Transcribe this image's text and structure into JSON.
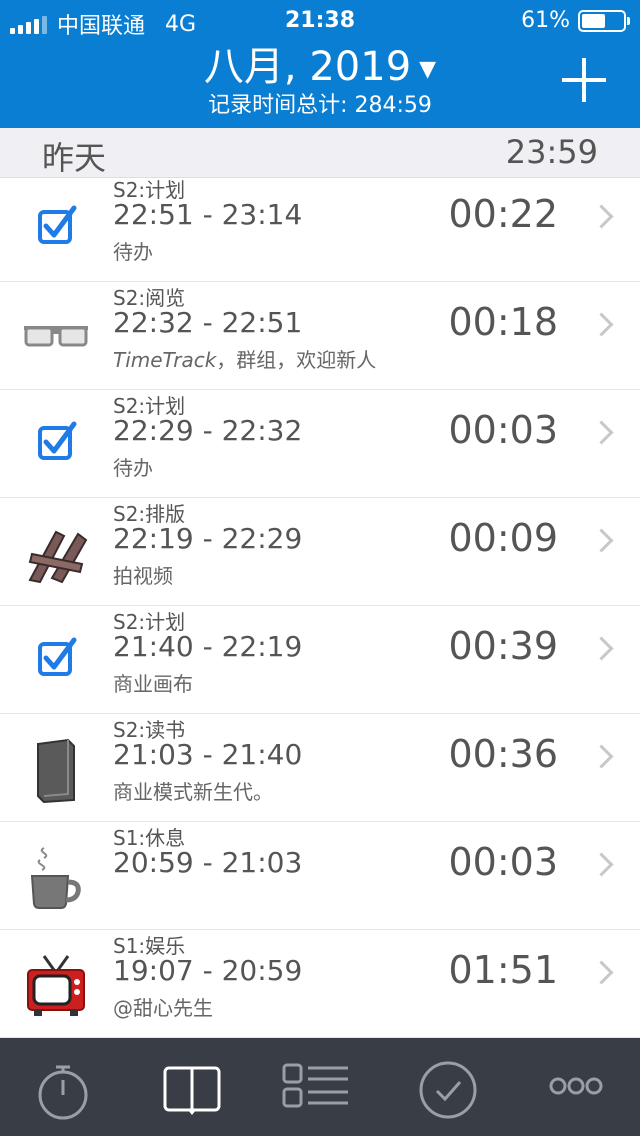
{
  "status": {
    "carrier": "中国联通",
    "network": "4G",
    "time": "21:38",
    "battery": "61%",
    "battery_level": 0.61
  },
  "header": {
    "title": "八月, 2019",
    "caret": "▼",
    "subtitle": "记录时间总计: 284:59",
    "add_icon": "plus-icon"
  },
  "section": {
    "label": "昨天",
    "total": "23:59"
  },
  "entries": [
    {
      "icon": "checkbox-icon",
      "category": "S2:计划",
      "range": "22:51 - 23:14",
      "note": "待办",
      "duration": "00:22"
    },
    {
      "icon": "glasses-icon",
      "category": "S2:阅览",
      "range": "22:32 - 22:51",
      "note_italic": "TimeTrack",
      "note": "，群组，欢迎新人",
      "duration": "00:18"
    },
    {
      "icon": "checkbox-icon",
      "category": "S2:计划",
      "range": "22:29 - 22:32",
      "note": "待办",
      "duration": "00:03"
    },
    {
      "icon": "typesetting-icon",
      "category": "S2:排版",
      "range": "22:19 - 22:29",
      "note": "拍视频",
      "duration": "00:09"
    },
    {
      "icon": "checkbox-icon",
      "category": "S2:计划",
      "range": "21:40 - 22:19",
      "note": "商业画布",
      "duration": "00:39"
    },
    {
      "icon": "book-icon",
      "category": "S2:读书",
      "range": "21:03 - 21:40",
      "note": "商业模式新生代。",
      "duration": "00:36"
    },
    {
      "icon": "coffee-cup-icon",
      "category": "S1:休息",
      "range": "20:59 - 21:03",
      "note": "",
      "duration": "00:03"
    },
    {
      "icon": "tv-icon",
      "category": "S1:娱乐",
      "range": "19:07 - 20:59",
      "note": "@甜心先生",
      "duration": "01:51"
    }
  ],
  "tabs": [
    {
      "name": "stopwatch-icon"
    },
    {
      "name": "log-book-icon",
      "selected": true
    },
    {
      "name": "categories-list-icon"
    },
    {
      "name": "goals-check-icon"
    },
    {
      "name": "more-icon"
    }
  ],
  "colors": {
    "header": "#0a7ed3",
    "tabbar": "#393d46",
    "accent": "#1f7be6"
  }
}
